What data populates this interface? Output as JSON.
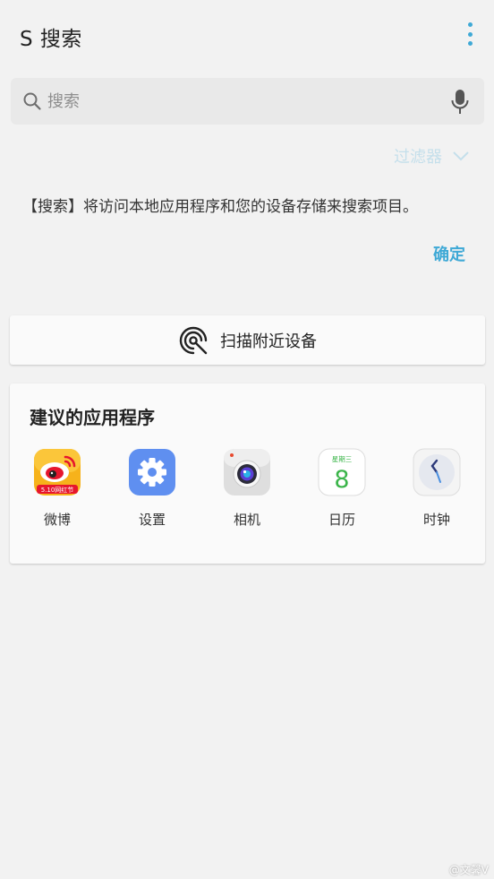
{
  "header": {
    "title": "S 搜索",
    "more_icon": "more-vert-icon"
  },
  "search": {
    "placeholder": "搜索",
    "value": "",
    "search_icon": "search-icon",
    "mic_icon": "microphone-icon"
  },
  "filter": {
    "label": "过滤器",
    "icon": "chevron-down-icon"
  },
  "notice": {
    "text": "【搜索】将访问本地应用程序和您的设备存储来搜索项目。",
    "confirm_label": "确定"
  },
  "scan": {
    "label": "扫描附近设备",
    "icon": "nearby-scan-icon"
  },
  "suggested": {
    "title": "建议的应用程序",
    "apps": [
      {
        "label": "微博",
        "icon": "weibo-icon",
        "badge": "5.10网红节"
      },
      {
        "label": "设置",
        "icon": "settings-gear-icon"
      },
      {
        "label": "相机",
        "icon": "camera-icon"
      },
      {
        "label": "日历",
        "icon": "calendar-icon",
        "weekday": "星期三",
        "day": "8"
      },
      {
        "label": "时钟",
        "icon": "clock-icon"
      }
    ]
  },
  "watermark": "@文馨V",
  "colors": {
    "accent": "#3fa9d6",
    "background": "#f2f2f2",
    "card": "#fafafa"
  }
}
